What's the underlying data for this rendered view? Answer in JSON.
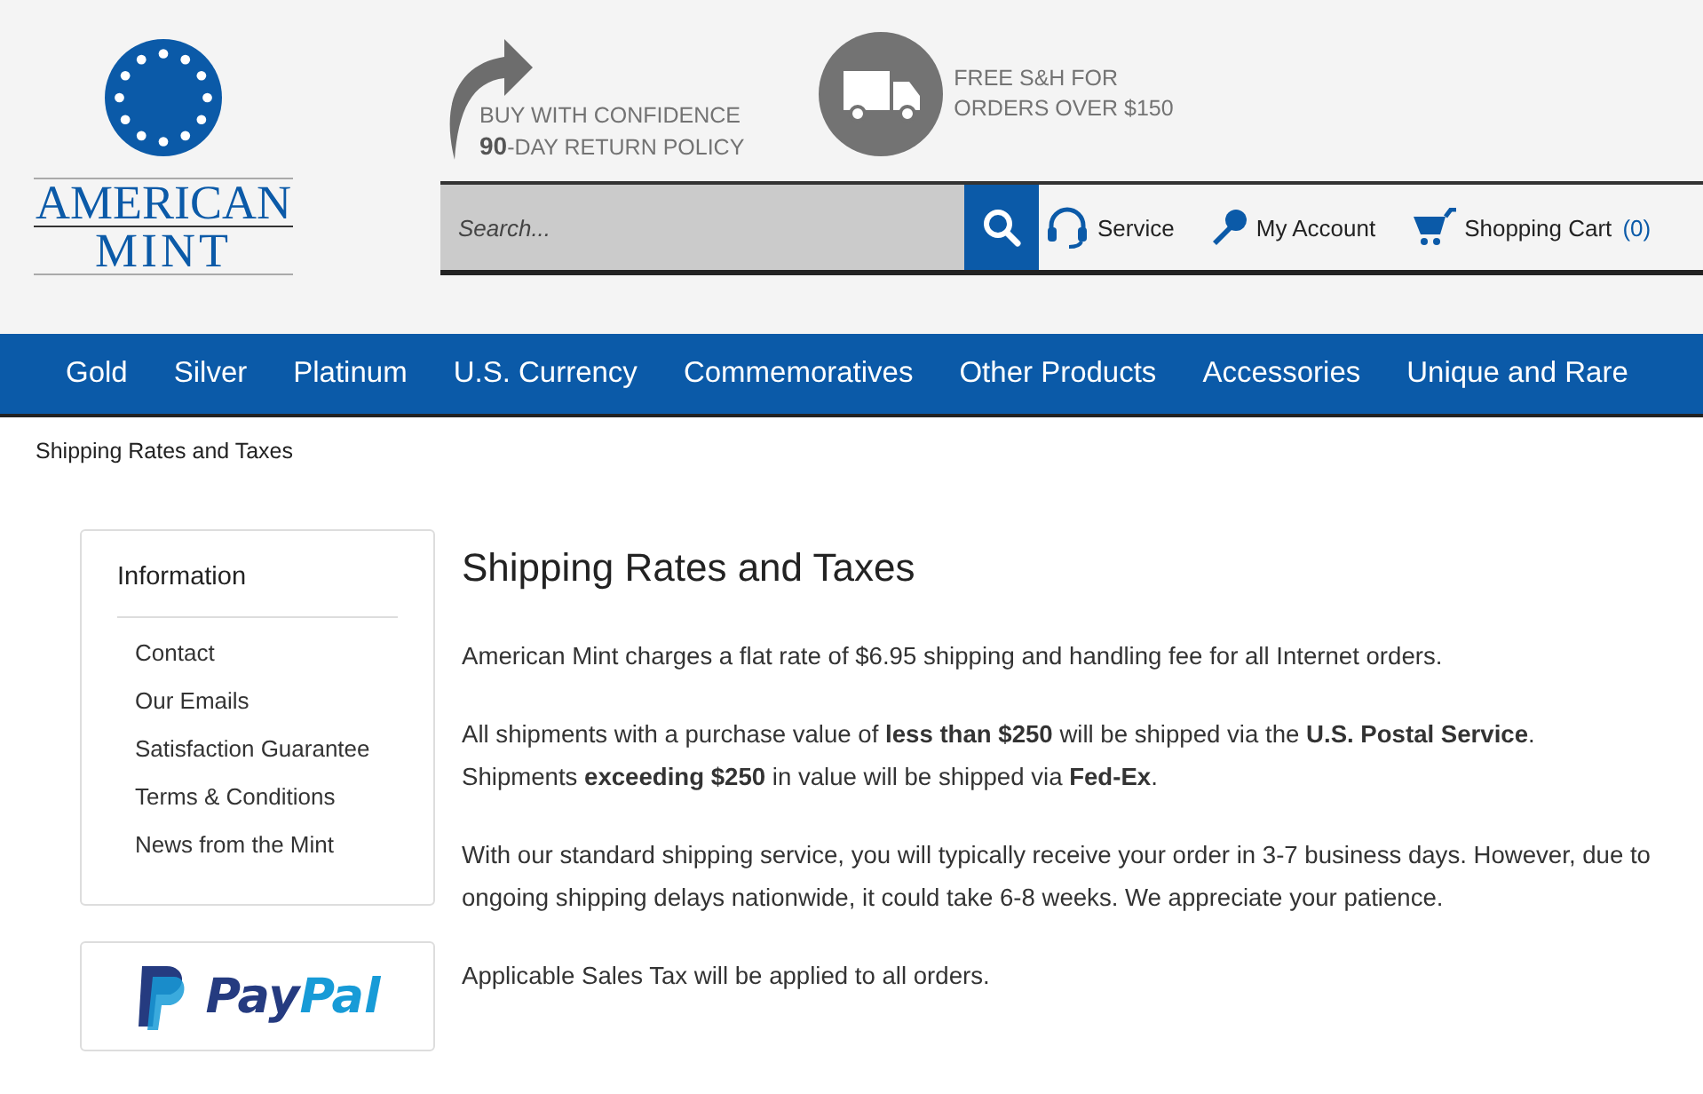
{
  "logo": {
    "line_1": "AMERICAN",
    "line_2": "MINT"
  },
  "promos": [
    {
      "kind": "return",
      "line_1": "BUY WITH CONFIDENCE",
      "line_2_strong": "90",
      "line_2": "-DAY RETURN POLICY"
    },
    {
      "kind": "shipping",
      "line_1": "FREE S&H FOR",
      "line_2": "ORDERS OVER $150"
    }
  ],
  "search": {
    "placeholder": "Search..."
  },
  "header_links": [
    {
      "kind": "service",
      "label": "Service"
    },
    {
      "kind": "account",
      "label": "My Account"
    },
    {
      "kind": "cart",
      "label": "Shopping Cart",
      "count": "(0)"
    }
  ],
  "nav": [
    "Gold",
    "Silver",
    "Platinum",
    "U.S. Currency",
    "Commemoratives",
    "Other Products",
    "Accessories",
    "Unique and Rare"
  ],
  "breadcrumb": "Shipping Rates and Taxes",
  "sidebar": {
    "title": "Information",
    "items": [
      "Contact",
      "Our Emails",
      "Satisfaction Guarantee",
      "Terms & Conditions",
      "News from the Mint"
    ]
  },
  "paypal": {
    "part_1": "Pay",
    "part_2": "Pal"
  },
  "content": {
    "title": "Shipping Rates and Taxes",
    "paragraphs": [
      [
        "American Mint charges a flat rate of $6.95 shipping and handling fee for all Internet orders."
      ],
      [
        "All shipments with a purchase value of **less than $250** will be shipped via the **U.S. Postal Service**.",
        "Shipments **exceeding $250** in value will be shipped via **Fed-Ex**."
      ],
      [
        "With our standard shipping service, you will typically receive your order in 3-7 business days. However, due to ongoing shipping delays nationwide, it could take 6-8 weeks. We appreciate your patience."
      ],
      [
        "Applicable Sales Tax will be applied to all orders."
      ]
    ]
  }
}
